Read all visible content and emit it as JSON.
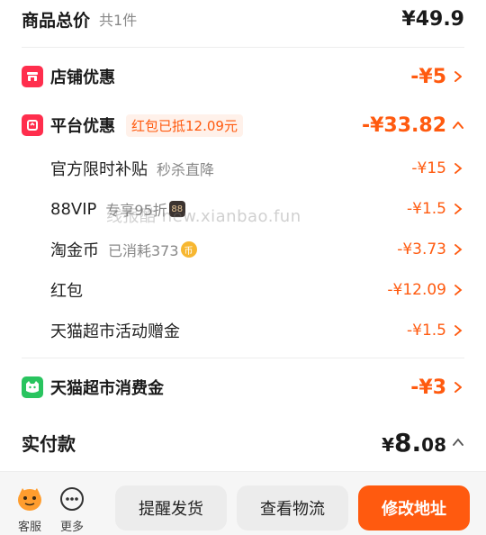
{
  "header": {
    "title": "商品总价",
    "count": "共1件",
    "total": "¥49.9"
  },
  "shop_discount": {
    "label": "店铺优惠",
    "amount": "-¥5"
  },
  "platform_discount": {
    "label": "平台优惠",
    "tag": "红包已抵12.09元",
    "amount": "-¥33.82"
  },
  "sub_items": [
    {
      "label": "官方限时补贴",
      "note": "秒杀直降",
      "amount": "-¥15"
    },
    {
      "label": "88VIP",
      "note": "专享95折",
      "badge": "88",
      "amount": "-¥1.5"
    },
    {
      "label": "淘金币",
      "note": "已消耗373",
      "badge": "币",
      "amount": "-¥3.73"
    },
    {
      "label": "红包",
      "note": "",
      "amount": "-¥12.09"
    },
    {
      "label": "天猫超市活动赠金",
      "note": "",
      "amount": "-¥1.5"
    }
  ],
  "watermark": "线报酷 new.xianbao.fun",
  "tmall_gold": {
    "label": "天猫超市消费金",
    "amount": "-¥3"
  },
  "actual_pay": {
    "label": "实付款",
    "currency": "¥",
    "amount_main": "8.",
    "amount_decimals": "08"
  },
  "bottom": {
    "service_label": "客服",
    "more_label": "更多",
    "remind_button": "提醒发货",
    "logistics_button": "查看物流",
    "modify_button": "修改地址"
  },
  "colors": {
    "accent": "#ff5a0f",
    "red_icon": "#ff2e4d",
    "green_icon": "#29c45f"
  }
}
